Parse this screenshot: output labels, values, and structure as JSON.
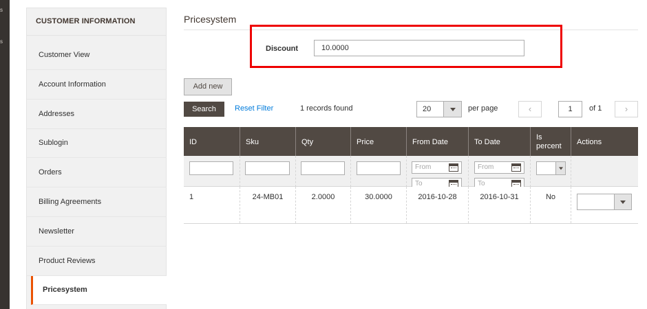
{
  "leftbar": {
    "fragments": [
      "s",
      "s"
    ]
  },
  "sidebar": {
    "title": "CUSTOMER INFORMATION",
    "items": [
      {
        "label": "Customer View"
      },
      {
        "label": "Account Information"
      },
      {
        "label": "Addresses"
      },
      {
        "label": "Sublogin"
      },
      {
        "label": "Orders"
      },
      {
        "label": "Billing Agreements"
      },
      {
        "label": "Newsletter"
      },
      {
        "label": "Product Reviews"
      },
      {
        "label": "Pricesystem",
        "active": true
      }
    ]
  },
  "main": {
    "title": "Pricesystem",
    "discount": {
      "label": "Discount",
      "value": "10.0000",
      "highlight_color": "#ee0000"
    },
    "add_new_label": "Add new",
    "search_label": "Search",
    "reset_filter_label": "Reset Filter",
    "records_found": "1 records found",
    "per_page_value": "20",
    "per_page_label": "per page",
    "page_value": "1",
    "page_of": "of 1",
    "prev_glyph": "‹",
    "next_glyph": "›"
  },
  "grid": {
    "columns": [
      "ID",
      "Sku",
      "Qty",
      "Price",
      "From Date",
      "To Date",
      "Is percent",
      "Actions"
    ],
    "is_percent_lines": [
      "Is",
      "percent"
    ],
    "date_placeholders": {
      "from": "From",
      "to": "To"
    },
    "rows": [
      {
        "id": "1",
        "sku": "24-MB01",
        "qty": "2.0000",
        "price": "30.0000",
        "from_date": "2016-10-28",
        "to_date": "2016-10-31",
        "is_percent": "No"
      }
    ]
  },
  "colors": {
    "header_bg": "#514943",
    "accent": "#eb5202",
    "link": "#007bdb"
  }
}
